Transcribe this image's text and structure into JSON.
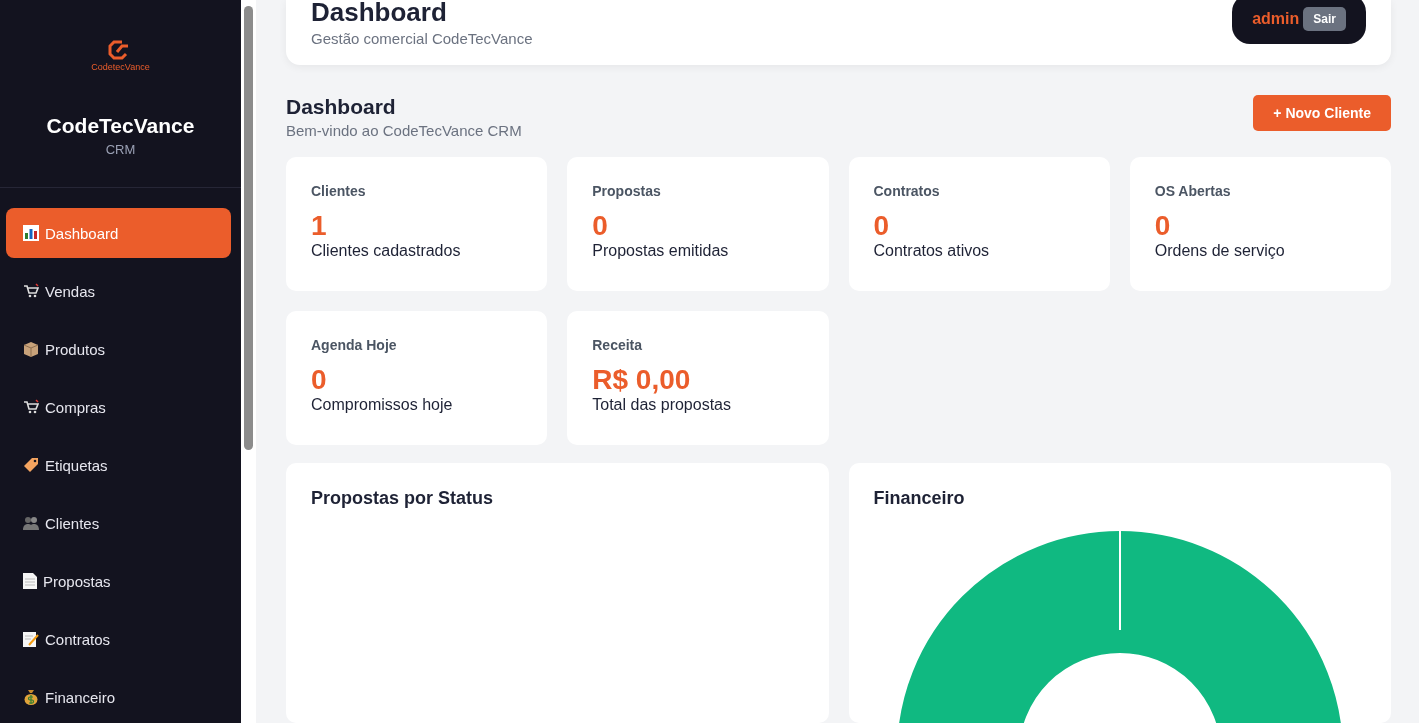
{
  "sidebar": {
    "logo_text": "CodetecVance",
    "title": "CodeTecVance",
    "subtitle": "CRM",
    "items": [
      {
        "label": "Dashboard",
        "kind": "chart",
        "selected": true
      },
      {
        "label": "Vendas",
        "kind": "cart",
        "selected": false
      },
      {
        "label": "Produtos",
        "kind": "box",
        "selected": false
      },
      {
        "label": "Compras",
        "kind": "cart",
        "selected": false
      },
      {
        "label": "Etiquetas",
        "kind": "tag",
        "selected": false
      },
      {
        "label": "Clientes",
        "kind": "people",
        "selected": false
      },
      {
        "label": "Propostas",
        "kind": "document",
        "selected": false
      },
      {
        "label": "Contratos",
        "kind": "memo",
        "selected": false
      },
      {
        "label": "Financeiro",
        "kind": "moneybag",
        "selected": false
      }
    ]
  },
  "header": {
    "title": "Dashboard",
    "subtitle": "Gestão comercial CodeTecVance",
    "user": "admin",
    "logout_button": "Sair"
  },
  "page": {
    "title": "Dashboard",
    "subtitle": "Bem-vindo ao CodeTecVance CRM",
    "new_button": "+ Novo Cliente"
  },
  "stats": [
    {
      "label": "Clientes",
      "value": "1",
      "caption": "Clientes cadastrados"
    },
    {
      "label": "Propostas",
      "value": "0",
      "caption": "Propostas emitidas"
    },
    {
      "label": "Contratos",
      "value": "0",
      "caption": "Contratos ativos"
    },
    {
      "label": "OS Abertas",
      "value": "0",
      "caption": "Ordens de serviço"
    },
    {
      "label": "Agenda Hoje",
      "value": "0",
      "caption": "Compromissos hoje"
    },
    {
      "label": "Receita",
      "value": "R$ 0,00",
      "caption": "Total das propostas"
    }
  ],
  "panels": [
    {
      "title": "Propostas por Status",
      "kind": "empty"
    },
    {
      "title": "Financeiro",
      "kind": "donut"
    }
  ]
}
